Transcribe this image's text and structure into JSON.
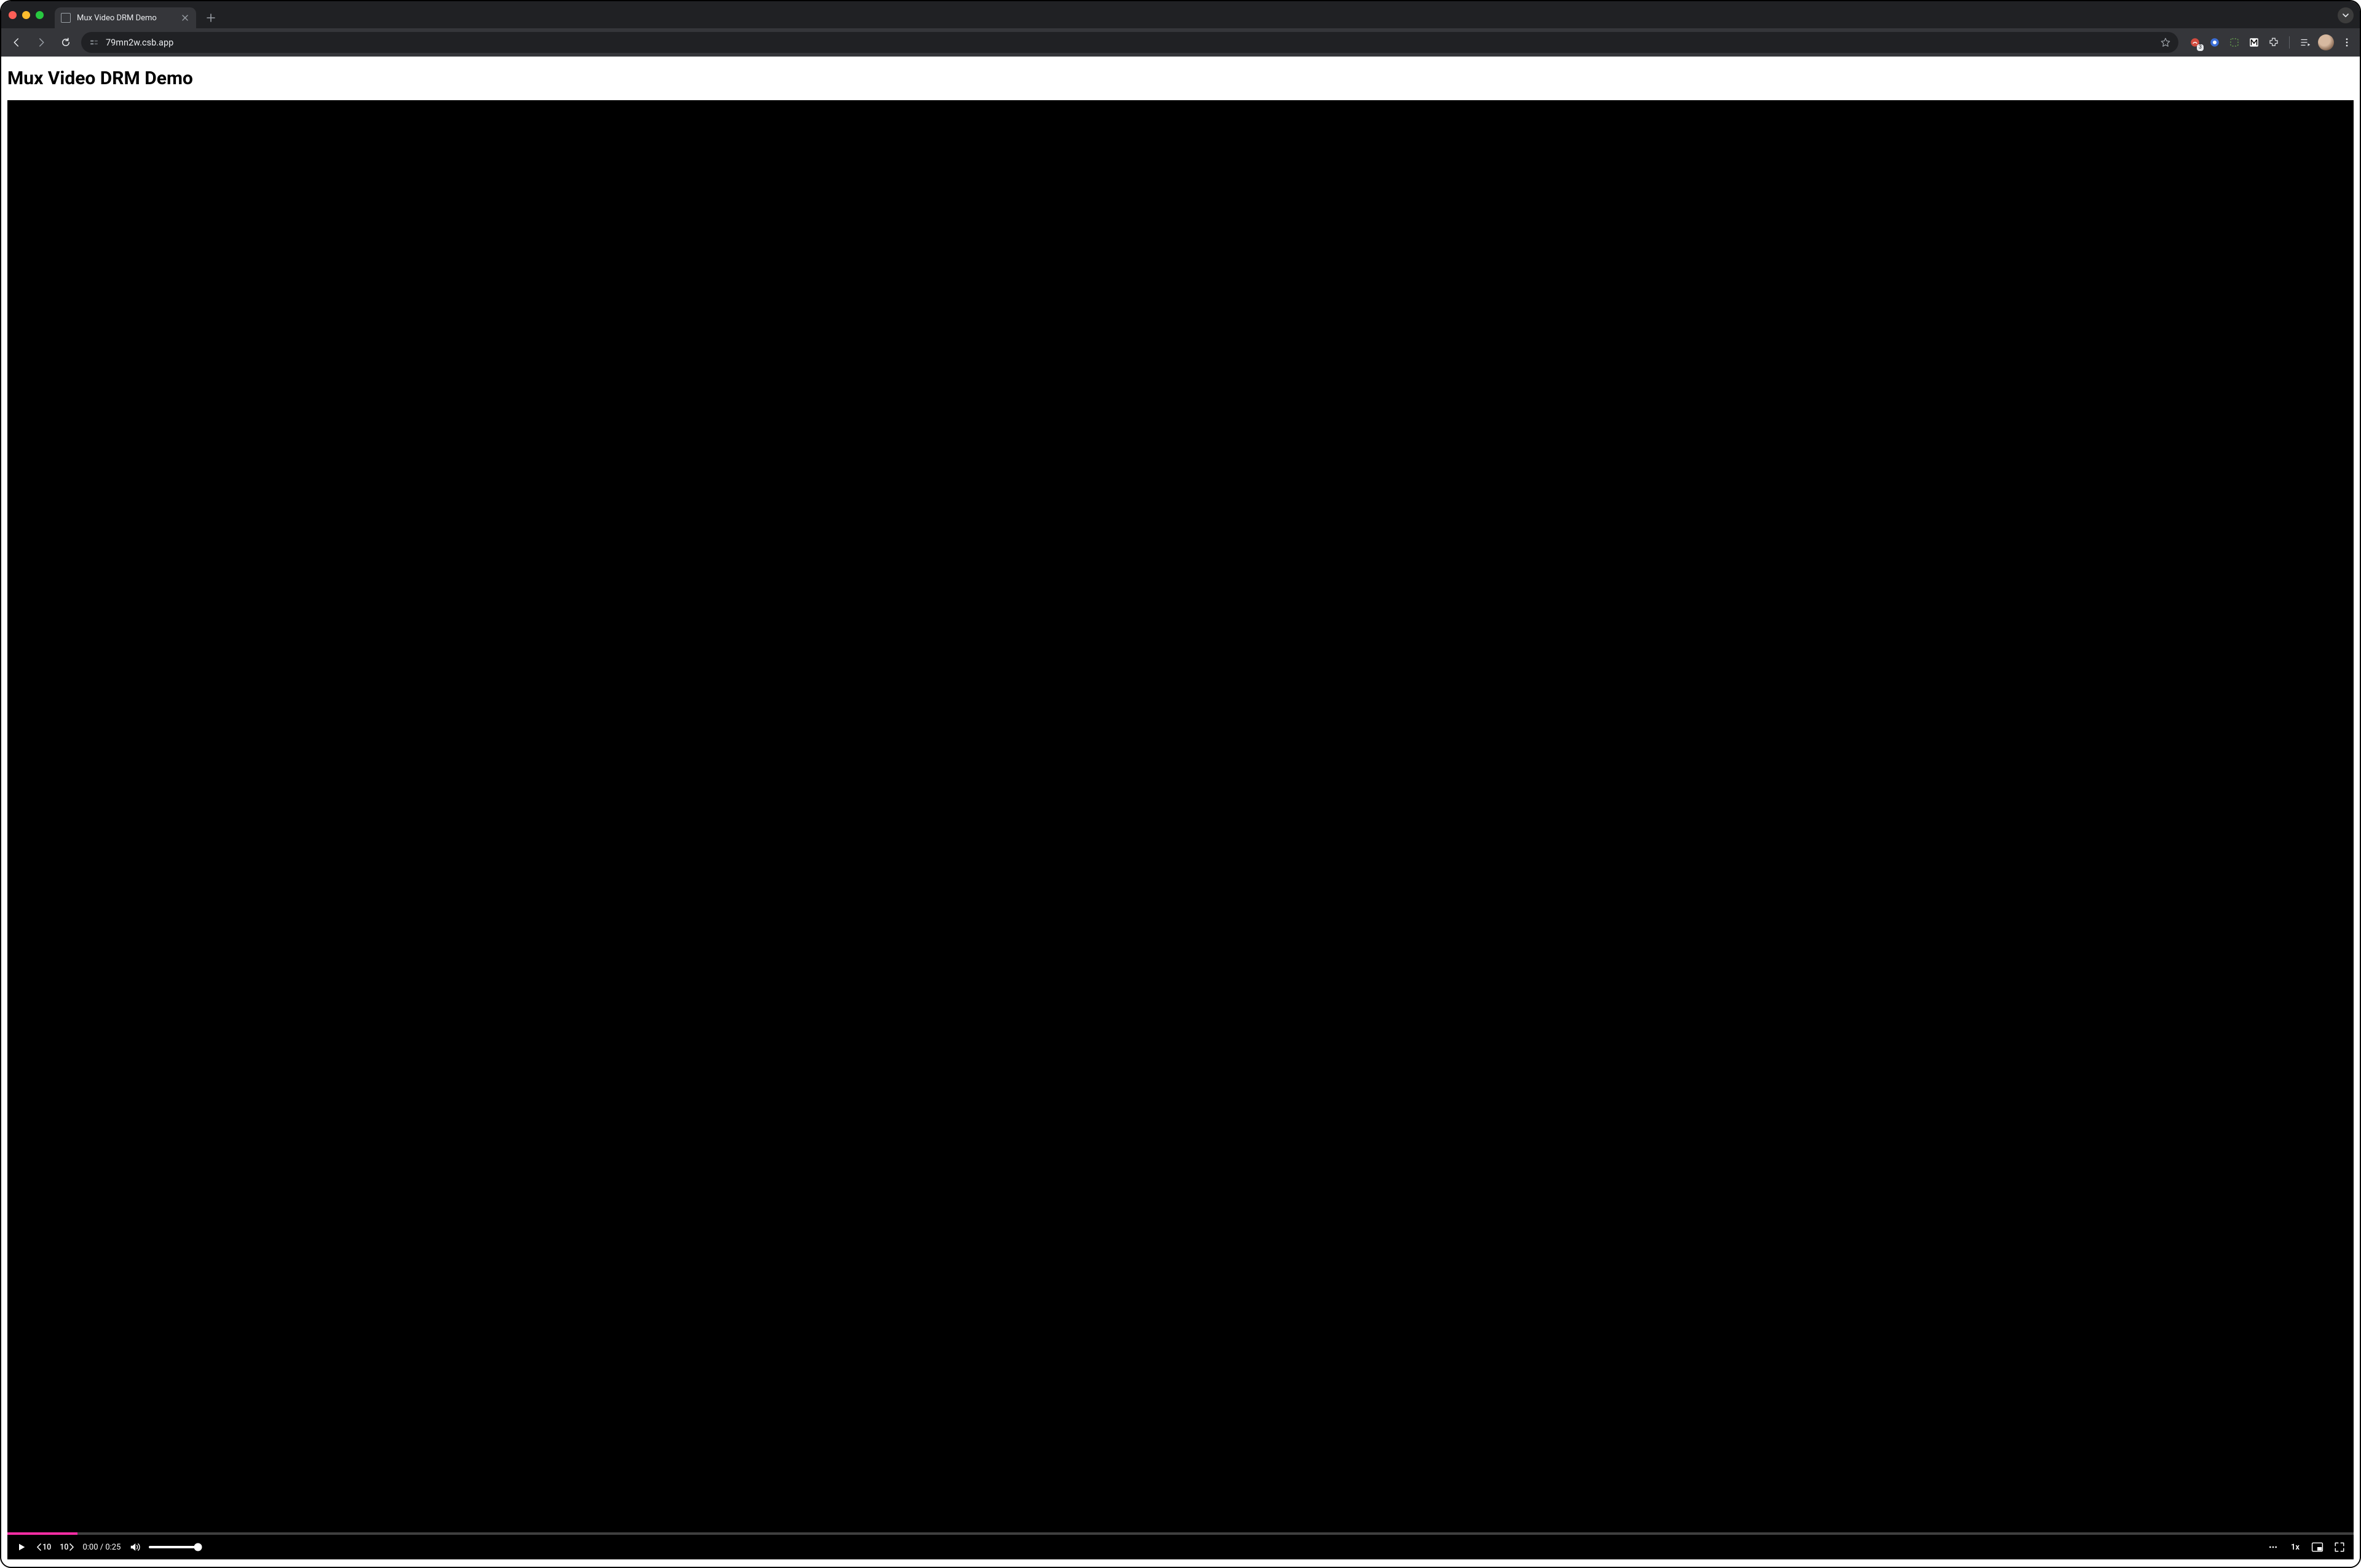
{
  "browser": {
    "tab_title": "Mux Video DRM Demo",
    "url": "79mn2w.csb.app"
  },
  "page": {
    "heading": "Mux Video DRM Demo"
  },
  "player": {
    "skip_back_label": "10",
    "skip_fwd_label": "10",
    "current_time": "0:00",
    "time_separator": " / ",
    "duration": "0:25",
    "progress_percent": 3,
    "volume_percent": 100,
    "playback_rate_label": "1x"
  }
}
